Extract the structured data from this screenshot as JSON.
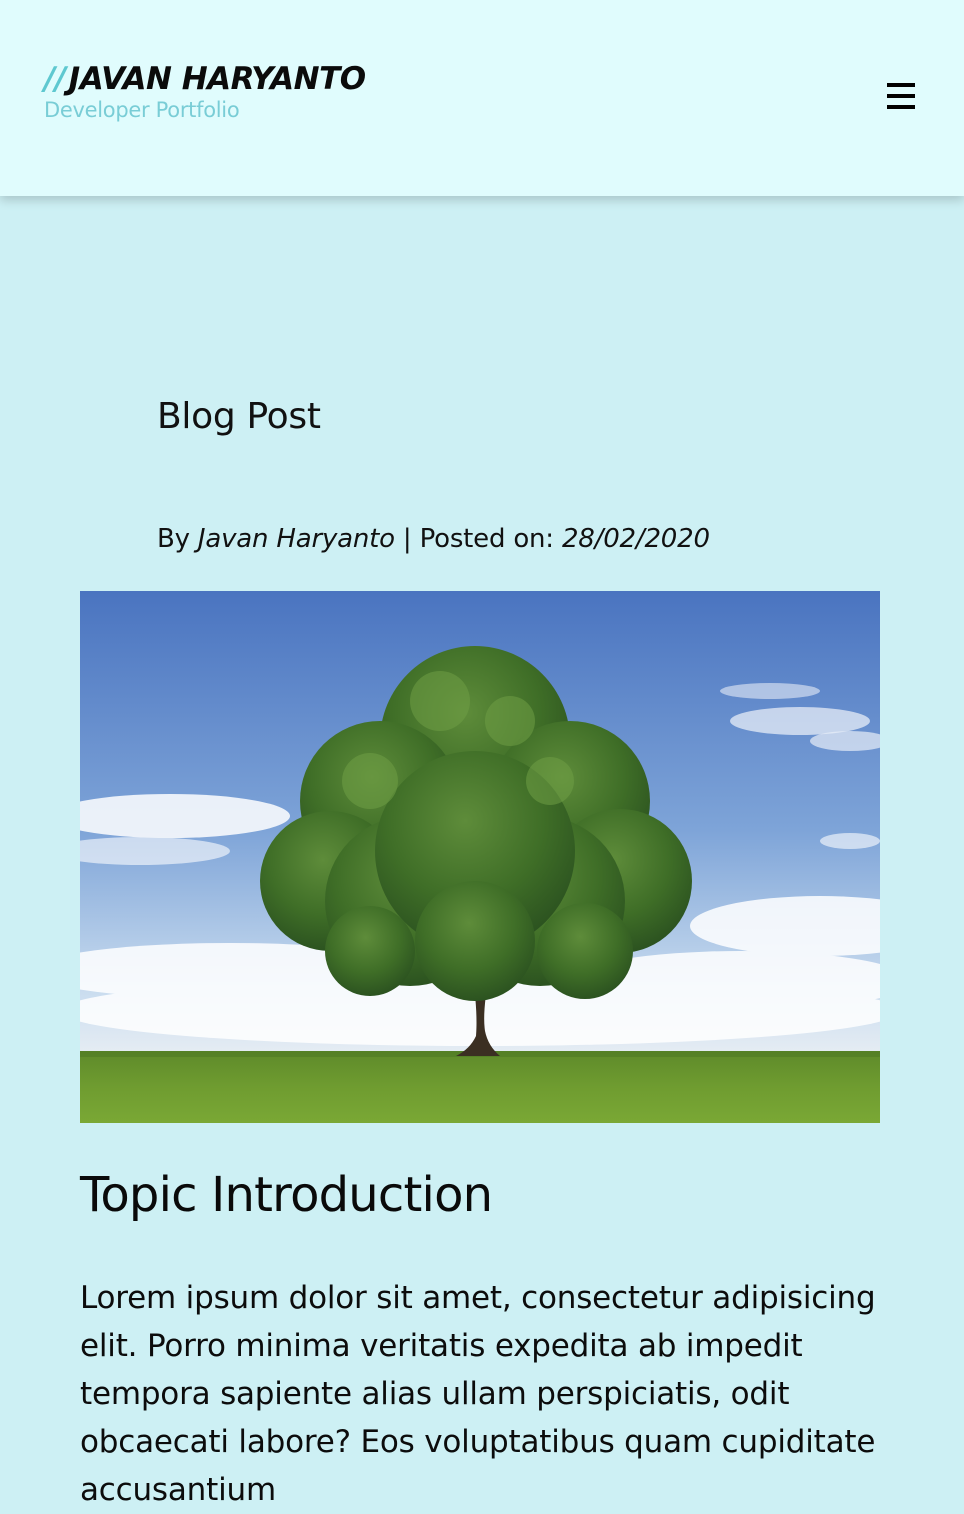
{
  "header": {
    "logo_slashes": "//",
    "logo_name": "JAVAN HARYANTO",
    "logo_subtitle": "Developer Portfolio",
    "menu_icon": "hamburger-menu-icon"
  },
  "post": {
    "heading": "Blog Post",
    "by_label": "By",
    "author": "Javan Haryanto",
    "separator": "|",
    "posted_label": "Posted on:",
    "date": "28/02/2020",
    "image_subject": "tree-in-field",
    "section_title": "Topic Introduction",
    "body": "Lorem ipsum dolor sit amet, consectetur adipisicing elit. Porro minima veritatis expedita ab impedit tempora sapiente alias ullam perspiciatis, odit obcaecati labore? Eos voluptatibus quam cupiditate accusantium"
  },
  "colors": {
    "header_bg": "#e0fcfd",
    "page_bg": "#cdf0f4",
    "accent": "#5ec8d0"
  }
}
